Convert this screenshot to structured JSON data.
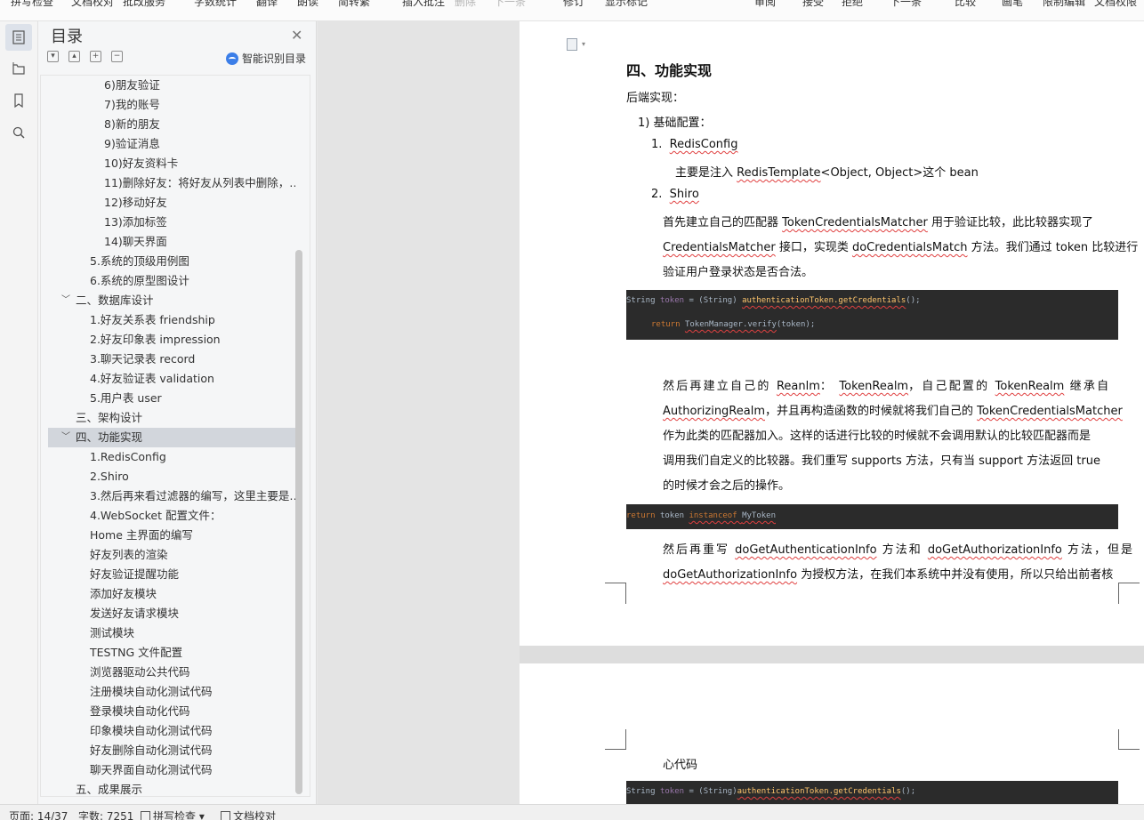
{
  "ribbon": {
    "items": [
      {
        "label": "拼写检查",
        "dim": false
      },
      {
        "label": "文档校对",
        "dim": false
      },
      {
        "label": "批改服务",
        "dim": false
      },
      {
        "label": "字数统计",
        "dim": false
      },
      {
        "label": "翻译",
        "dim": false
      },
      {
        "label": "朗读",
        "dim": false
      },
      {
        "label": "简转繁",
        "dim": false
      },
      {
        "label": "插入批注",
        "dim": false
      },
      {
        "label": "删除",
        "dim": true
      },
      {
        "label": "下一条",
        "dim": true
      },
      {
        "label": "修订",
        "dim": false
      },
      {
        "label": "显示标记",
        "dim": false
      },
      {
        "label": "审阅",
        "dim": false
      },
      {
        "label": "接受",
        "dim": false
      },
      {
        "label": "拒绝",
        "dim": false
      },
      {
        "label": "下一条",
        "dim": false
      },
      {
        "label": "比较",
        "dim": false
      },
      {
        "label": "画笔",
        "dim": false
      },
      {
        "label": "限制编辑",
        "dim": false
      },
      {
        "label": "文档权限",
        "dim": false
      }
    ]
  },
  "rail": {
    "icons": [
      "toc-icon",
      "folder-icon",
      "bookmark-icon",
      "search-icon"
    ]
  },
  "nav": {
    "title": "目录",
    "smart_label": "智能识别目录",
    "toc": [
      {
        "text": "6)朋友验证",
        "level": 3,
        "arrow": "",
        "selected": false
      },
      {
        "text": "7)我的账号",
        "level": 3,
        "arrow": "",
        "selected": false
      },
      {
        "text": "8)新的朋友",
        "level": 3,
        "arrow": "",
        "selected": false
      },
      {
        "text": "9)验证消息",
        "level": 3,
        "arrow": "",
        "selected": false
      },
      {
        "text": "10)好友资料卡",
        "level": 3,
        "arrow": "",
        "selected": false
      },
      {
        "text": "11)删除好友：将好友从列表中删除，…",
        "level": 3,
        "arrow": "",
        "selected": false
      },
      {
        "text": "12)移动好友",
        "level": 3,
        "arrow": "",
        "selected": false
      },
      {
        "text": "13)添加标签",
        "level": 3,
        "arrow": "",
        "selected": false
      },
      {
        "text": "14)聊天界面",
        "level": 3,
        "arrow": "",
        "selected": false
      },
      {
        "text": "5.系统的顶级用例图",
        "level": 2,
        "arrow": "",
        "selected": false
      },
      {
        "text": "6.系统的原型图设计",
        "level": 2,
        "arrow": "",
        "selected": false
      },
      {
        "text": "二、数据库设计",
        "level": 1,
        "arrow": "﹀",
        "selected": false
      },
      {
        "text": "1.好友关系表 friendship",
        "level": 2,
        "arrow": "",
        "selected": false
      },
      {
        "text": "2.好友印象表 impression",
        "level": 2,
        "arrow": "",
        "selected": false
      },
      {
        "text": "3.聊天记录表 record",
        "level": 2,
        "arrow": "",
        "selected": false
      },
      {
        "text": "4.好友验证表 validation",
        "level": 2,
        "arrow": "",
        "selected": false
      },
      {
        "text": "5.用户表 user",
        "level": 2,
        "arrow": "",
        "selected": false
      },
      {
        "text": "三、架构设计",
        "level": 1,
        "arrow": "",
        "selected": false
      },
      {
        "text": "四、功能实现",
        "level": 1,
        "arrow": "﹀",
        "selected": true
      },
      {
        "text": "1.RedisConfig",
        "level": 2,
        "arrow": "",
        "selected": false
      },
      {
        "text": "2.Shiro",
        "level": 2,
        "arrow": "",
        "selected": false
      },
      {
        "text": "3.然后再来看过滤器的编写，这里主要是…",
        "level": 2,
        "arrow": "",
        "selected": false
      },
      {
        "text": "4.WebSocket 配置文件：",
        "level": 2,
        "arrow": "",
        "selected": false
      },
      {
        "text": "Home 主界面的编写",
        "level": 2,
        "arrow": "",
        "selected": false
      },
      {
        "text": "好友列表的渲染",
        "level": 2,
        "arrow": "",
        "selected": false
      },
      {
        "text": " 好友验证提醒功能",
        "level": 2,
        "arrow": "",
        "selected": false
      },
      {
        "text": "添加好友模块",
        "level": 2,
        "arrow": "",
        "selected": false
      },
      {
        "text": "发送好友请求模块",
        "level": 2,
        "arrow": "",
        "selected": false
      },
      {
        "text": "测试模块",
        "level": 2,
        "arrow": "",
        "selected": false
      },
      {
        "text": "TESTNG 文件配置",
        "level": 2,
        "arrow": "",
        "selected": false
      },
      {
        "text": "浏览器驱动公共代码",
        "level": 2,
        "arrow": "",
        "selected": false
      },
      {
        "text": "注册模块自动化测试代码",
        "level": 2,
        "arrow": "",
        "selected": false
      },
      {
        "text": "登录模块自动化代码",
        "level": 2,
        "arrow": "",
        "selected": false
      },
      {
        "text": "印象模块自动化测试代码",
        "level": 2,
        "arrow": "",
        "selected": false
      },
      {
        "text": "好友删除自动化测试代码",
        "level": 2,
        "arrow": "",
        "selected": false
      },
      {
        "text": "聊天界面自动化测试代码",
        "level": 2,
        "arrow": "",
        "selected": false
      },
      {
        "text": "五、成果展示",
        "level": 1,
        "arrow": "",
        "selected": false
      }
    ]
  },
  "doc": {
    "heading": "四、功能实现",
    "backend": "后端实现：",
    "basic_config": "1)  基础配置：",
    "item1_label": "1.",
    "item1": "RedisConfig",
    "item1_desc_pre": "主要是注入 ",
    "item1_desc_sq": "RedisTemplate",
    "item1_desc_post": "<Object, Object>这个 bean",
    "item2_label": "2.",
    "item2": "Shiro",
    "shiro_p1_l1_a": "首先建立自己的匹配器 ",
    "shiro_p1_l1_sq": "TokenCredentialsMatcher",
    "shiro_p1_l1_b": " 用于验证比较，此比较器实现了",
    "shiro_p1_l2_sq1": "CredentialsMatcher",
    "shiro_p1_l2_a": " 接口，实现类 ",
    "shiro_p1_l2_sq2": "doCredentialsMatch",
    "shiro_p1_l2_b": " 方法。我们通过 token 比较进行",
    "shiro_p1_l3": "验证用户登录状态是否合法。",
    "code1_line1": [
      "String ",
      "token",
      " = (String) ",
      "authenticationToken.getCredentials",
      "();"
    ],
    "code1_line2": [
      "return ",
      "TokenManager.verify",
      "(token);"
    ],
    "p2_l1_a": "然后再建立自己的 ",
    "p2_l1_sq1": "Reanlm",
    "p2_l1_b": "： ",
    "p2_l1_sq2": "TokenRealm",
    "p2_l1_c": "，自己配置的 ",
    "p2_l1_sq3": "TokenRealm",
    "p2_l1_d": " 继承自",
    "p2_l2_sq1": "AuthorizingRealm",
    "p2_l2_a": "，并且再构造函数的时候就将我们自己的 ",
    "p2_l2_sq2": "TokenCredentialsMatcher",
    "p2_l3": "作为此类的匹配器加入。这样的话进行比较的时候就不会调用默认的比较匹配器而是",
    "p2_l4": "调用我们自定义的比较器。我们重写 supports 方法，只有当 support 方法返回 true",
    "p2_l5": "的时候才会之后的操作。",
    "code2": [
      "return ",
      "token ",
      "instanceof ",
      "MyToken"
    ],
    "p3_l1_a": "然后再重写 ",
    "p3_l1_sq1": "doGetAuthenticationInfo",
    "p3_l1_b": " 方法和 ",
    "p3_l1_sq2": "doGetAuthorizationInfo",
    "p3_l1_c": " 方法，但是",
    "p3_l2_sq": "doGetAuthorizationInfo",
    "p3_l2_a": " 为授权方法，在我们本系统中并没有使用，所以只给出前者核",
    "page2_text": "心代码",
    "code3": [
      "String ",
      "token",
      " = (String)",
      "authenticationToken.getCredentials",
      "();"
    ]
  },
  "status": {
    "page": "页面: 14/37",
    "words": "字数: 7251",
    "spell": "拼写检查",
    "proof": "文档校对"
  }
}
